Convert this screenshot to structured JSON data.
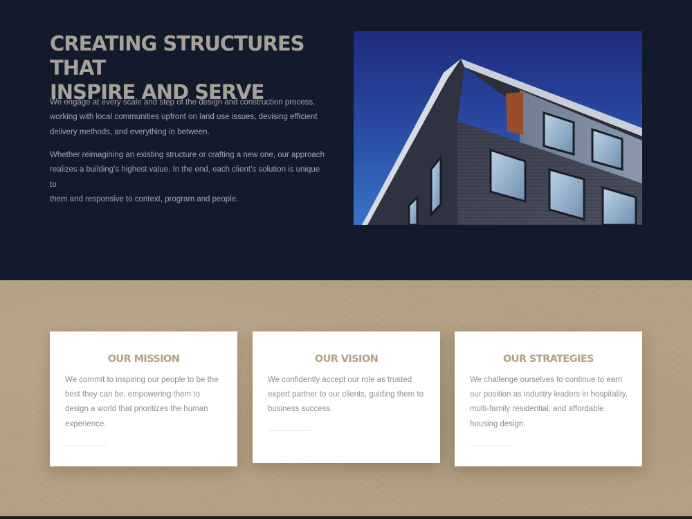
{
  "hero": {
    "title": "CREATING STRUCTURES THAT\nINSPIRE AND SERVE",
    "paragraph_1": "We engage at every scale and step of the design and construction process,\nworking with local communities upfront on land use issues, devising efficient\ndelivery methods, and everything in between.",
    "paragraph_2": "Whether reimagining an existing structure or crafting a new one, our approach\nrealizes a building’s highest value. In the end, each client’s solution is unique to\nthem and responsive to context, program and people."
  },
  "cards": [
    {
      "title": "OUR MISSION",
      "text": "We commit to inspiring our people to be the best they can be, empowering them to design a world that prioritizes the human experience."
    },
    {
      "title": "OUR VISION",
      "text": "We confidently accept our role as trusted expert partner to our clients, guiding them to business success."
    },
    {
      "title": "OUR STRATEGIES",
      "text": "We challenge ourselves to continue to earn our position as industry leaders in hospitality, multi-family residential, and affordable housing design."
    }
  ],
  "colors": {
    "hero_background": "#121a2b",
    "accent_tan": "#b4a083",
    "card_background": "#ffffff",
    "title_gray": "#a6a29b"
  }
}
